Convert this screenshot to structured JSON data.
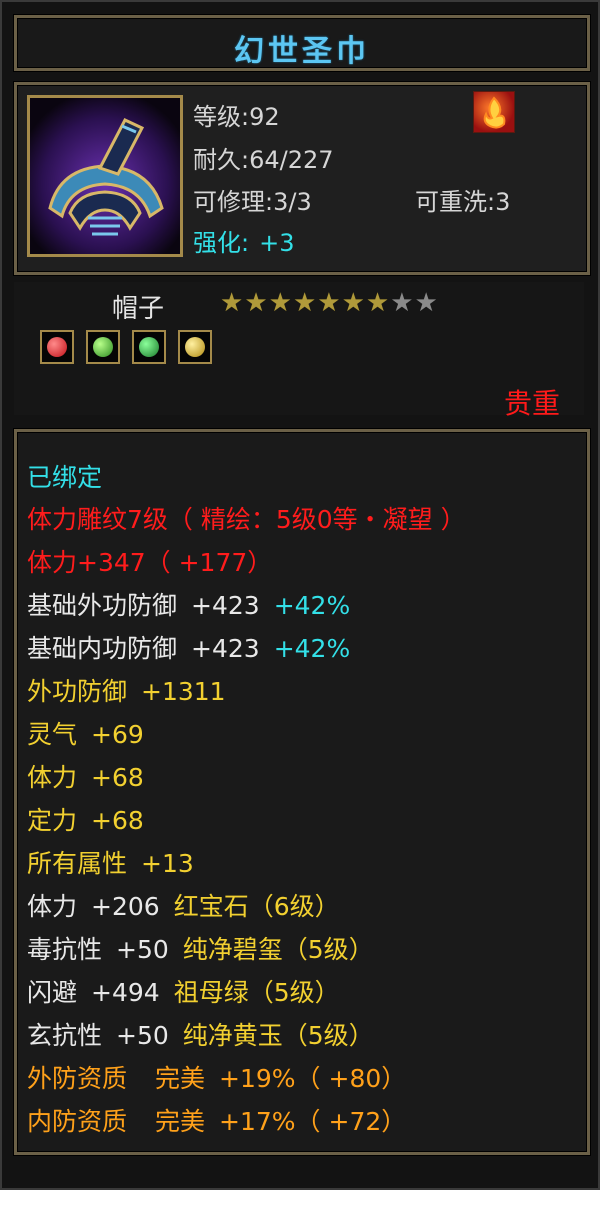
{
  "item": {
    "name": "幻世圣巾",
    "level_label": "等级:92",
    "durability_label": "耐久:64/227",
    "repair_label": "可修理:3/3",
    "rewash_label": "可重洗:3",
    "enhance_label": "强化:",
    "enhance_value": "+3",
    "type": "帽子",
    "stars_filled": 7,
    "stars_total": 9,
    "rarity": "贵重",
    "icon": "headband-icon",
    "special_icon": "flame-bonus-icon"
  },
  "gems": [
    {
      "name": "red-gem-icon",
      "color": "#e0202a"
    },
    {
      "name": "green-gem-icon",
      "color": "#3aa03a"
    },
    {
      "name": "green-jade-icon",
      "color": "#2a8a3a"
    },
    {
      "name": "yellow-gem-icon",
      "color": "#d8b020"
    }
  ],
  "attributes": {
    "bound": "已绑定",
    "engraving": "体力雕纹7级（ 精绘：5级0等・凝望 ）",
    "stamina_bonus": "体力+347（ +177）",
    "base_out_def": {
      "label": "基础外功防御",
      "value": "+423",
      "pct": "+42%"
    },
    "base_in_def": {
      "label": "基础内功防御",
      "value": "+423",
      "pct": "+42%"
    },
    "out_def": {
      "label": "外功防御",
      "value": "+1311"
    },
    "spirit": {
      "label": "灵气",
      "value": "+69"
    },
    "stamina": {
      "label": "体力",
      "value": "+68"
    },
    "focus": {
      "label": "定力",
      "value": "+68"
    },
    "all_attr": {
      "label": "所有属性",
      "value": "+13"
    },
    "gem1": {
      "label": "体力",
      "value": "+206",
      "gem": "红宝石（6级）"
    },
    "gem2": {
      "label": "毒抗性",
      "value": "+50",
      "gem": "纯净碧玺（5级）"
    },
    "gem3": {
      "label": "闪避",
      "value": "+494",
      "gem": "祖母绿（5级）"
    },
    "gem4": {
      "label": "玄抗性",
      "value": "+50",
      "gem": "纯净黄玉（5级）"
    },
    "q_out": {
      "label": "外防资质",
      "grade": "完美",
      "value": "+19%（ +80）"
    },
    "q_in": {
      "label": "内防资质",
      "grade": "完美",
      "value": "+17%（ +72）"
    }
  },
  "colors": {
    "title": "#5cc6f2",
    "normal": "#e8e8e8",
    "yellow": "#f2d030",
    "red": "#ff1c1c",
    "cyan": "#33e0e8",
    "orange": "#ffa11a",
    "border_gold": "#a48a4a"
  }
}
